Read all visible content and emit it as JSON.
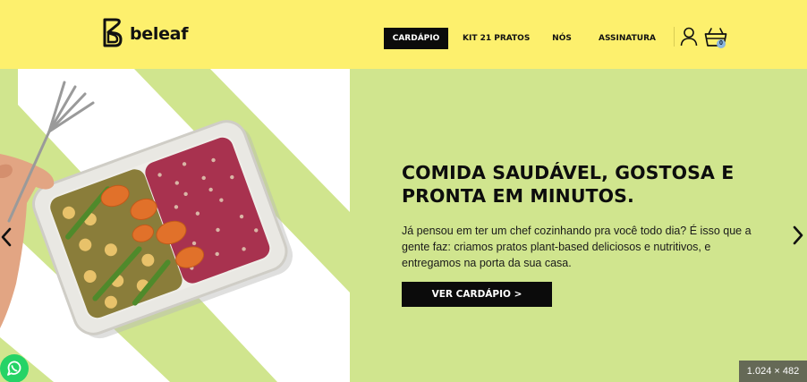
{
  "brand": {
    "name": "beleaf",
    "logo_icon": "beleaf-b-logo-icon"
  },
  "nav": {
    "items": [
      {
        "label": "CARDÁPIO",
        "active": true
      },
      {
        "label": "KIT 21 PRATOS",
        "active": false
      },
      {
        "label": "NÓS",
        "active": false
      },
      {
        "label": "ASSINATURA",
        "active": false
      }
    ],
    "user_icon": "user-icon",
    "cart_icon": "basket-icon",
    "cart_count": "0"
  },
  "hero": {
    "headline": "COMIDA SAUDÁVEL, GOSTOSA E PRONTA EM MINUTOS.",
    "description": "Já pensou em ter um chef cozinhando pra você todo dia? É isso que a gente faz: criamos pratos plant-based deliciosos e nutritivos, e entregamos na porta da sua casa.",
    "cta_label": "VER CARDÁPIO >",
    "prev_icon": "chevron-left-icon",
    "next_icon": "chevron-right-icon"
  },
  "floating": {
    "whatsapp_icon": "whatsapp-icon"
  },
  "image_size_badge": "1.024 × 482",
  "colors": {
    "header_bg": "#fdf06d",
    "hero_bg": "#d0e58e",
    "stripe": "#ffffff",
    "button_bg": "#0b0b0b",
    "text": "#0d0d0d",
    "whatsapp": "#25d366"
  }
}
